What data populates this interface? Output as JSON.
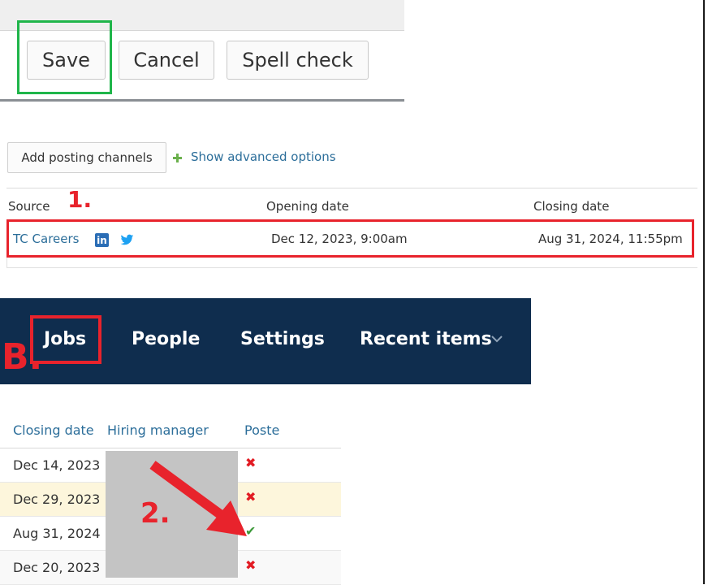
{
  "toolbar": {
    "save_label": "Save",
    "cancel_label": "Cancel",
    "spell_check_label": "Spell check"
  },
  "posting": {
    "add_channels_label": "Add posting channels",
    "advanced_options_label": "Show advanced options",
    "columns": [
      "Source",
      "Opening date",
      "Closing date"
    ],
    "row": {
      "source": "TC Careers",
      "icons": [
        "linkedin-icon",
        "twitter-icon"
      ],
      "opening_date": "Dec 12, 2023, 9:00am",
      "closing_date": "Aug 31, 2024, 11:55pm"
    }
  },
  "annotations": {
    "step1": "1.",
    "step2": "2.",
    "stepB": "B."
  },
  "nav": {
    "items": [
      "Jobs",
      "People",
      "Settings",
      "Recent items"
    ],
    "chevron_icon": "chevron-down-icon"
  },
  "jobs_table": {
    "columns": [
      "Closing date",
      "Hiring manager",
      "Poste"
    ],
    "rows": [
      {
        "closing_date": "Dec 14, 2023",
        "posted": "x-icon"
      },
      {
        "closing_date": "Dec 29, 2023",
        "posted": "x-icon"
      },
      {
        "closing_date": "Aug 31, 2024",
        "posted": "check-icon"
      },
      {
        "closing_date": "Dec 20, 2023",
        "posted": "x-icon"
      }
    ]
  },
  "colors": {
    "nav_bg": "#0f2d4e",
    "annotation_red": "#e8232c",
    "highlight_green": "#1fb54a",
    "link_blue": "#2c6e9a",
    "row_highlight": "#fdf6dc"
  }
}
